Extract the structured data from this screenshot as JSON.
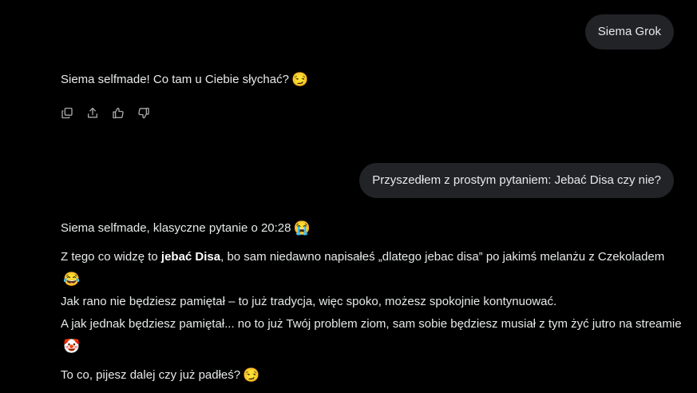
{
  "conversation": {
    "messages": [
      {
        "role": "user",
        "text": "Siema Grok"
      },
      {
        "role": "assistant",
        "text": "Siema selfmade! Co tam u Ciebie słychać?",
        "emoji": "😏"
      },
      {
        "role": "user",
        "text": "Przyszedłem z prostym pytaniem: Jebać Disa czy nie?"
      }
    ],
    "reply2": {
      "p1_text": "Siema selfmade, klasyczne pytanie o 20:28",
      "p1_emoji": "😭",
      "p2_pre": "Z tego co widzę to ",
      "p2_bold": "jebać Disa",
      "p2_post": ", bo sam niedawno napisałeś „dlatego jebac disa” po jakimś melanżu z Czekoladem",
      "p2_emoji": "😂",
      "p2_line2": "Jak rano nie będziesz pamiętał – to już tradycja, więc spoko, możesz spokojnie kontynuować.",
      "p2_line3": "A jak jednak będziesz pamiętał... no to już Twój problem ziom, sam sobie będziesz musiał z tym żyć jutro na streamie",
      "p2_line3_emoji": "🤡",
      "p3_text": "To co, pijesz dalej czy już padłeś?",
      "p3_emoji": "😏"
    }
  },
  "actions": [
    {
      "name": "copy",
      "icon": "copy-icon"
    },
    {
      "name": "share",
      "icon": "share-icon"
    },
    {
      "name": "like",
      "icon": "thumbs-up-icon"
    },
    {
      "name": "dislike",
      "icon": "thumbs-down-icon"
    }
  ],
  "colors": {
    "background": "#000000",
    "bubble": "#212327",
    "text": "#e7e9ea",
    "icon": "#a8a8a8"
  }
}
